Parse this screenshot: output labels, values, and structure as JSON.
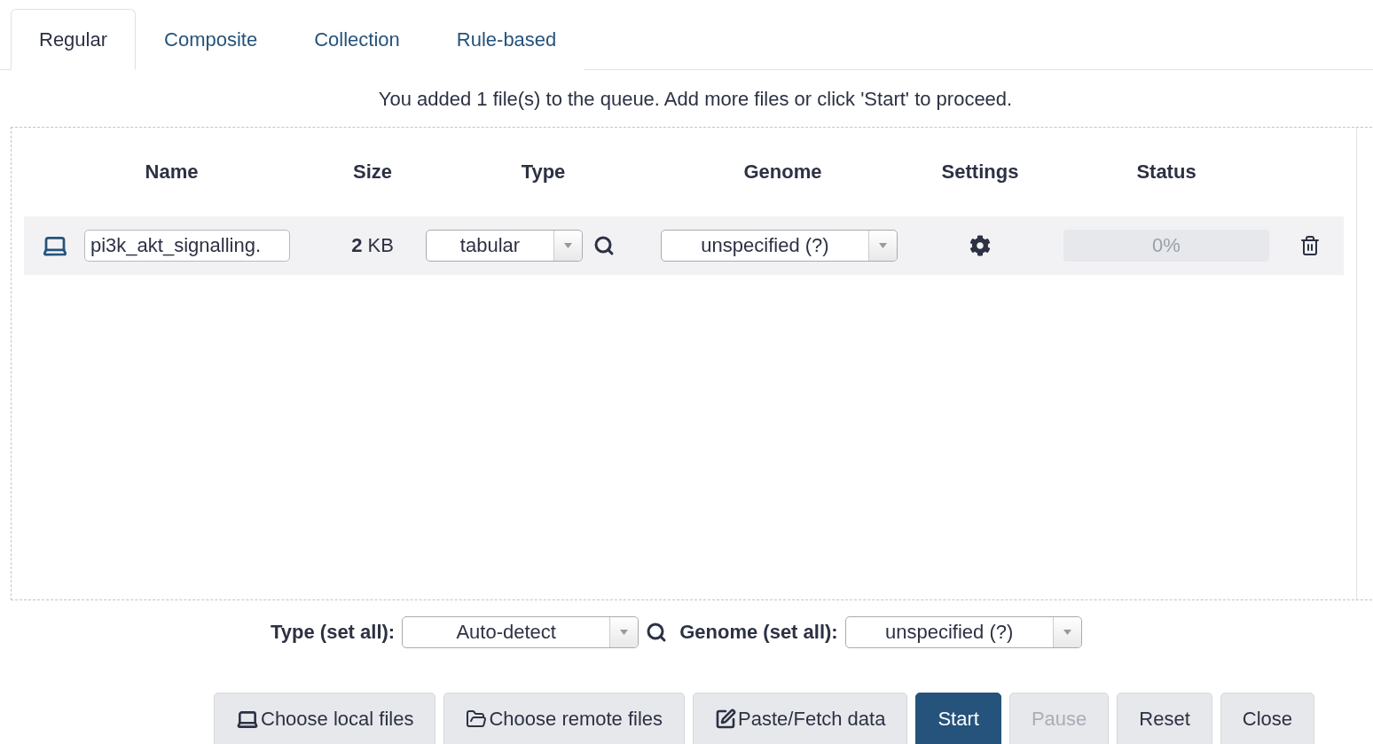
{
  "tabs": [
    {
      "label": "Regular",
      "selected": true
    },
    {
      "label": "Composite",
      "selected": false
    },
    {
      "label": "Collection",
      "selected": false
    },
    {
      "label": "Rule-based",
      "selected": false
    }
  ],
  "message": "You added 1 file(s) to the queue. Add more files or click 'Start' to proceed.",
  "table": {
    "columns": [
      "Name",
      "Size",
      "Type",
      "Genome",
      "Settings",
      "Status"
    ],
    "rows": [
      {
        "name": "pi3k_akt_signalling.",
        "size": "**2** KB",
        "type": "tabular",
        "genome": "unspecified (?)",
        "status": {
          "level": 0,
          "reading": "0%"
        }
      }
    ]
  },
  "set_all": {
    "type_label": "Type (set all):",
    "type_value": "Auto-detect",
    "genome_label": "Genome (set all):",
    "genome_value": "unspecified (?)"
  },
  "buttons": [
    {
      "label": "Choose local files",
      "kind": "local",
      "primary": false,
      "disabled": false
    },
    {
      "label": "Choose remote files",
      "kind": "remote",
      "primary": false,
      "disabled": false
    },
    {
      "label": "Paste/Fetch data",
      "kind": "paste",
      "primary": false,
      "disabled": false
    },
    {
      "label": "Start",
      "kind": "plain",
      "primary": true,
      "disabled": false
    },
    {
      "label": "Pause",
      "kind": "plain",
      "primary": false,
      "disabled": true
    },
    {
      "label": "Reset",
      "kind": "plain",
      "primary": false,
      "disabled": false
    },
    {
      "label": "Close",
      "kind": "plain",
      "primary": false,
      "disabled": false
    }
  ]
}
